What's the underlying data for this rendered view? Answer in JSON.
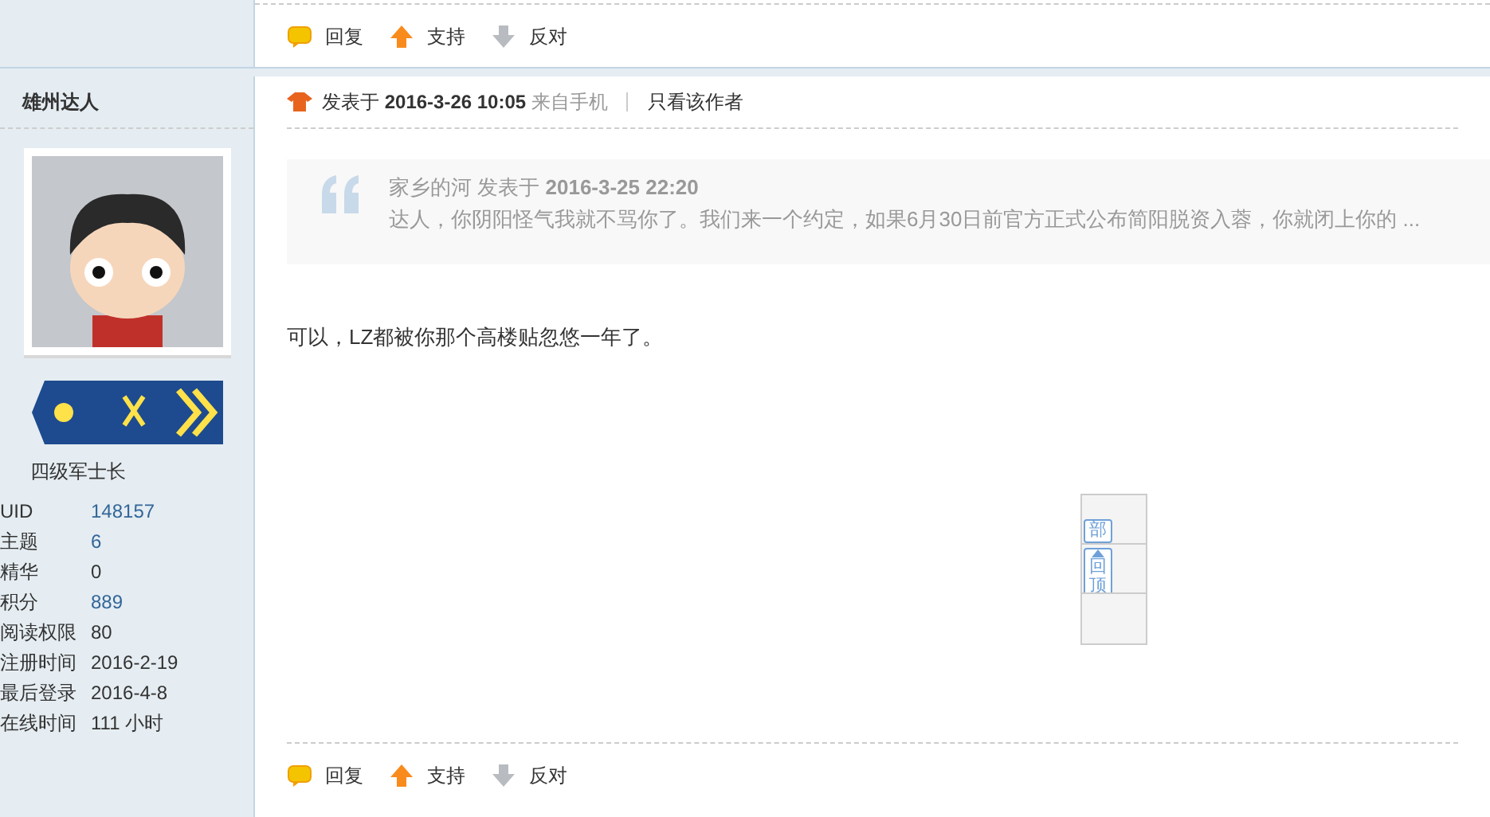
{
  "top_actions": [
    {
      "kind": "reply",
      "label": "回复"
    },
    {
      "kind": "support",
      "label": "支持"
    },
    {
      "kind": "oppose",
      "label": "反对"
    }
  ],
  "author": {
    "name": "雄州达人",
    "rank_title": "四级军士长",
    "stats": [
      {
        "label": "UID",
        "value": "148157",
        "link": true
      },
      {
        "label": "主题",
        "value": "6",
        "link": true
      },
      {
        "label": "精华",
        "value": "0",
        "link": false
      },
      {
        "label": "积分",
        "value": "889",
        "link": true
      },
      {
        "label": "阅读权限",
        "value": "80",
        "link": false
      },
      {
        "label": "注册时间",
        "value": "2016-2-19",
        "link": false
      },
      {
        "label": "最后登录",
        "value": "2016-4-8",
        "link": false
      },
      {
        "label": "在线时间",
        "value": "111 小时",
        "link": false
      }
    ]
  },
  "post": {
    "posted_label": "发表于",
    "posted_time": "2016-3-26 10:05",
    "source": "来自手机",
    "author_only": "只看该作者",
    "quote": {
      "author": "家乡的河",
      "posted_label": "发表于",
      "time": "2016-3-25 22:20",
      "text": "达人，你阴阳怪气我就不骂你了。我们来一个约定，如果6月30日前官方正式公布简阳脱资入蓉，你就闭上你的 ..."
    },
    "content": "可以，LZ都被你那个高楼贴忽悠一年了。"
  },
  "float_bar": [
    {
      "kind": "plain",
      "label": "部"
    },
    {
      "kind": "top",
      "label": "回顶"
    },
    {
      "kind": "empty"
    }
  ],
  "bottom_actions": [
    {
      "kind": "reply",
      "label": "回复"
    },
    {
      "kind": "support",
      "label": "支持"
    },
    {
      "kind": "oppose",
      "label": "反对"
    }
  ]
}
